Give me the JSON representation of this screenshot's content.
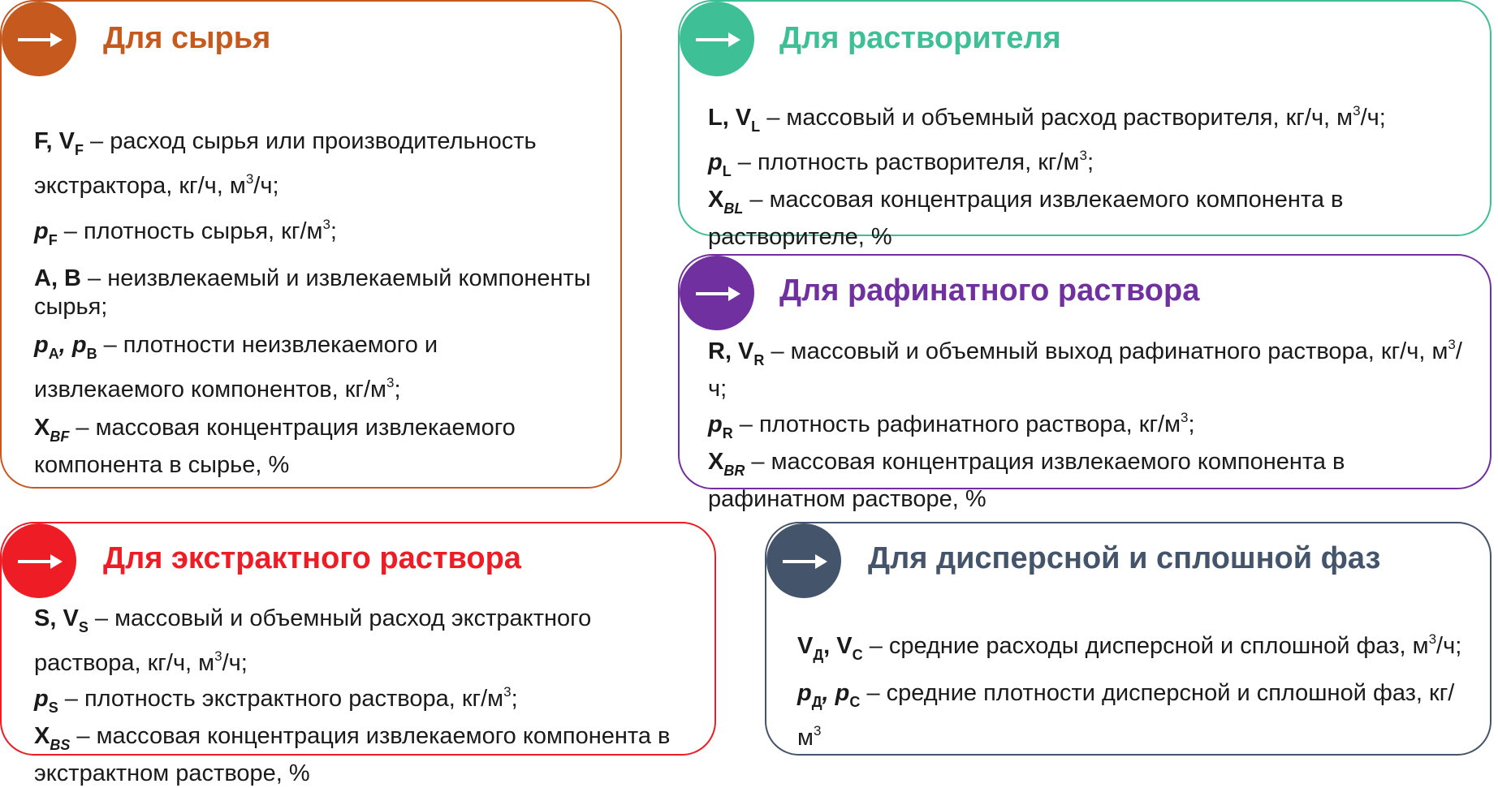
{
  "colors": {
    "feed": "#c65a1e",
    "solvent": "#3fbf95",
    "raffinate": "#7030a0",
    "extract": "#ee1c24",
    "phases": "#44546a"
  },
  "icons": {
    "badge_icon": "arrow-right-icon"
  },
  "feed": {
    "title": "Для сырья",
    "items": [
      {
        "sym": "F, V",
        "sub": "F",
        "text": " – расход сырья или производительность экстрактора, кг/ч, м",
        "sup": "3",
        "tail": "/ч;"
      },
      {
        "sym": "p",
        "sub": "F",
        "text": " – плотность сырья, кг/м",
        "sup": "3",
        "tail": ";"
      },
      {
        "sym": "А, В",
        "text": " – неизвлекаемый и извлекаемый компоненты сырья;"
      },
      {
        "sym1": "p",
        "sub1": "A",
        "sym2": ", p",
        "sub2": "B",
        "text": " – плотности неизвлекаемого и извлекаемого компонентов, кг/м",
        "sup": "3",
        "tail": ";"
      },
      {
        "sym": "X",
        "sub": "BF",
        "text": " – массовая концентрация извлекаемого компонента в сырье, %"
      }
    ]
  },
  "solvent": {
    "title": "Для растворителя",
    "items": [
      {
        "sym": "L, V",
        "sub": "L",
        "text": " – массовый и объемный расход растворителя, кг/ч, м",
        "sup": "3",
        "tail": "/ч;"
      },
      {
        "sym": "p",
        "sub": "L",
        "text": " – плотность растворителя, кг/м",
        "sup": "3",
        "tail": ";"
      },
      {
        "sym": "X",
        "sub": "BL",
        "text": " – массовая концентрация извлекаемого компонента в растворителе, %"
      }
    ]
  },
  "raffinate": {
    "title": "Для рафинатного раствора",
    "items": [
      {
        "sym": "R, V",
        "sub": "R",
        "text": " – массовый и объемный выход рафинатного раствора, кг/ч, м",
        "sup": "3",
        "tail": "/ч;"
      },
      {
        "sym": "p",
        "sub": "R",
        "text": " – плотность рафинатного раствора, кг/м",
        "sup": "3",
        "tail": ";"
      },
      {
        "sym": "X",
        "sub": "BR",
        "text": " – массовая концентрация извлекаемого компонента в рафинатном растворе, %"
      }
    ]
  },
  "extract": {
    "title": "Для экстрактного раствора",
    "items": [
      {
        "sym": "S, V",
        "sub": "S",
        "text": " – массовый и объемный расход экстрактного раствора, кг/ч, м",
        "sup": "3",
        "tail": "/ч;"
      },
      {
        "sym": "p",
        "sub": "S",
        "text": " – плотность экстрактного раствора, кг/м",
        "sup": "3",
        "tail": ";"
      },
      {
        "sym": "X",
        "sub": "BS",
        "text": " – массовая концентрация извлекаемого компонента в экстрактном растворе, %"
      }
    ]
  },
  "phases": {
    "title": "Для дисперсной и сплошной фаз",
    "items": [
      {
        "sym1": "V",
        "sub1": "Д",
        "sym2": ", V",
        "sub2": "C",
        "text": " – средние расходы дисперсной и сплошной фаз, м",
        "sup": "3",
        "tail": "/ч;"
      },
      {
        "sym1": "p",
        "sub1": "Д",
        "sym2": ", p",
        "sub2": "C",
        "text": " – средние плотности дисперсной и сплошной фаз, кг/м",
        "sup": "3",
        "tail": ""
      }
    ]
  }
}
